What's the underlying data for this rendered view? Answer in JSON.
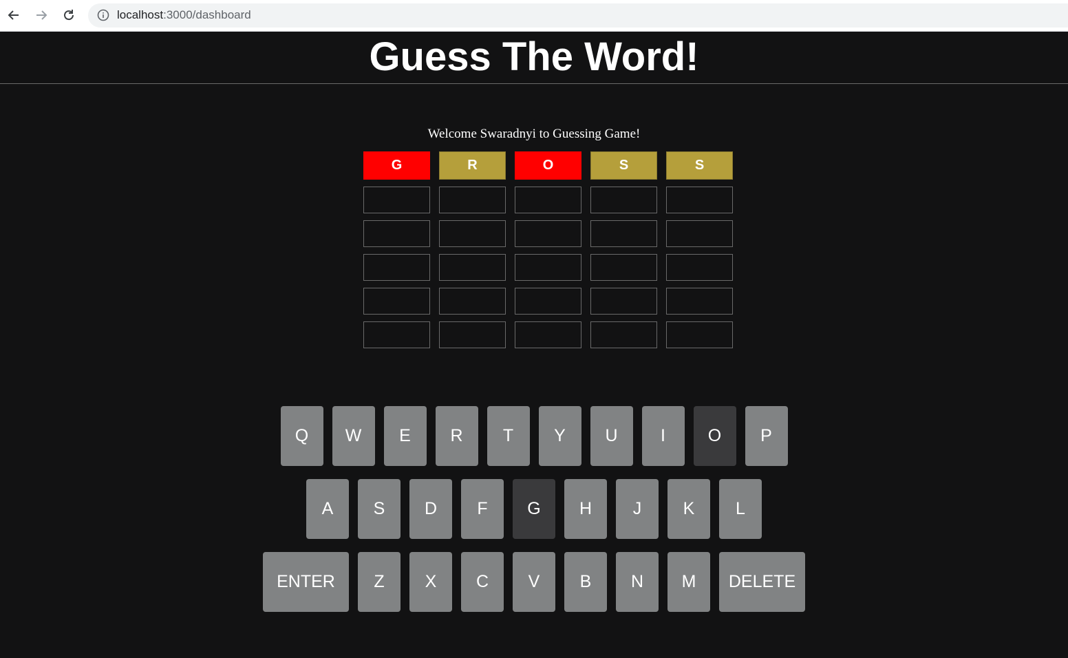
{
  "browser": {
    "url_host": "localhost",
    "url_path": ":3000/dashboard"
  },
  "header": {
    "title": "Guess The Word!"
  },
  "welcome": "Welcome Swaradnyi to Guessing Game!",
  "board": {
    "rows": [
      [
        {
          "letter": "G",
          "state": "wrong"
        },
        {
          "letter": "R",
          "state": "present"
        },
        {
          "letter": "O",
          "state": "wrong"
        },
        {
          "letter": "S",
          "state": "present"
        },
        {
          "letter": "S",
          "state": "present"
        }
      ],
      [
        {
          "letter": "",
          "state": "empty"
        },
        {
          "letter": "",
          "state": "empty"
        },
        {
          "letter": "",
          "state": "empty"
        },
        {
          "letter": "",
          "state": "empty"
        },
        {
          "letter": "",
          "state": "empty"
        }
      ],
      [
        {
          "letter": "",
          "state": "empty"
        },
        {
          "letter": "",
          "state": "empty"
        },
        {
          "letter": "",
          "state": "empty"
        },
        {
          "letter": "",
          "state": "empty"
        },
        {
          "letter": "",
          "state": "empty"
        }
      ],
      [
        {
          "letter": "",
          "state": "empty"
        },
        {
          "letter": "",
          "state": "empty"
        },
        {
          "letter": "",
          "state": "empty"
        },
        {
          "letter": "",
          "state": "empty"
        },
        {
          "letter": "",
          "state": "empty"
        }
      ],
      [
        {
          "letter": "",
          "state": "empty"
        },
        {
          "letter": "",
          "state": "empty"
        },
        {
          "letter": "",
          "state": "empty"
        },
        {
          "letter": "",
          "state": "empty"
        },
        {
          "letter": "",
          "state": "empty"
        }
      ],
      [
        {
          "letter": "",
          "state": "empty"
        },
        {
          "letter": "",
          "state": "empty"
        },
        {
          "letter": "",
          "state": "empty"
        },
        {
          "letter": "",
          "state": "empty"
        },
        {
          "letter": "",
          "state": "empty"
        }
      ]
    ]
  },
  "keyboard": {
    "rows": [
      [
        {
          "key": "Q"
        },
        {
          "key": "W"
        },
        {
          "key": "E"
        },
        {
          "key": "R"
        },
        {
          "key": "T"
        },
        {
          "key": "Y"
        },
        {
          "key": "U"
        },
        {
          "key": "I"
        },
        {
          "key": "O",
          "used": true
        },
        {
          "key": "P"
        }
      ],
      [
        {
          "key": "A"
        },
        {
          "key": "S"
        },
        {
          "key": "D"
        },
        {
          "key": "F"
        },
        {
          "key": "G",
          "used": true
        },
        {
          "key": "H"
        },
        {
          "key": "J"
        },
        {
          "key": "K"
        },
        {
          "key": "L"
        }
      ],
      [
        {
          "key": "ENTER",
          "wide": true
        },
        {
          "key": "Z"
        },
        {
          "key": "X"
        },
        {
          "key": "C"
        },
        {
          "key": "V"
        },
        {
          "key": "B"
        },
        {
          "key": "N"
        },
        {
          "key": "M"
        },
        {
          "key": "DELETE",
          "wide": true
        }
      ]
    ]
  },
  "colors": {
    "background": "#121213",
    "wrong": "#ff0000",
    "present": "#b59f3b",
    "key": "#818384",
    "key_used": "#3a3a3c"
  }
}
